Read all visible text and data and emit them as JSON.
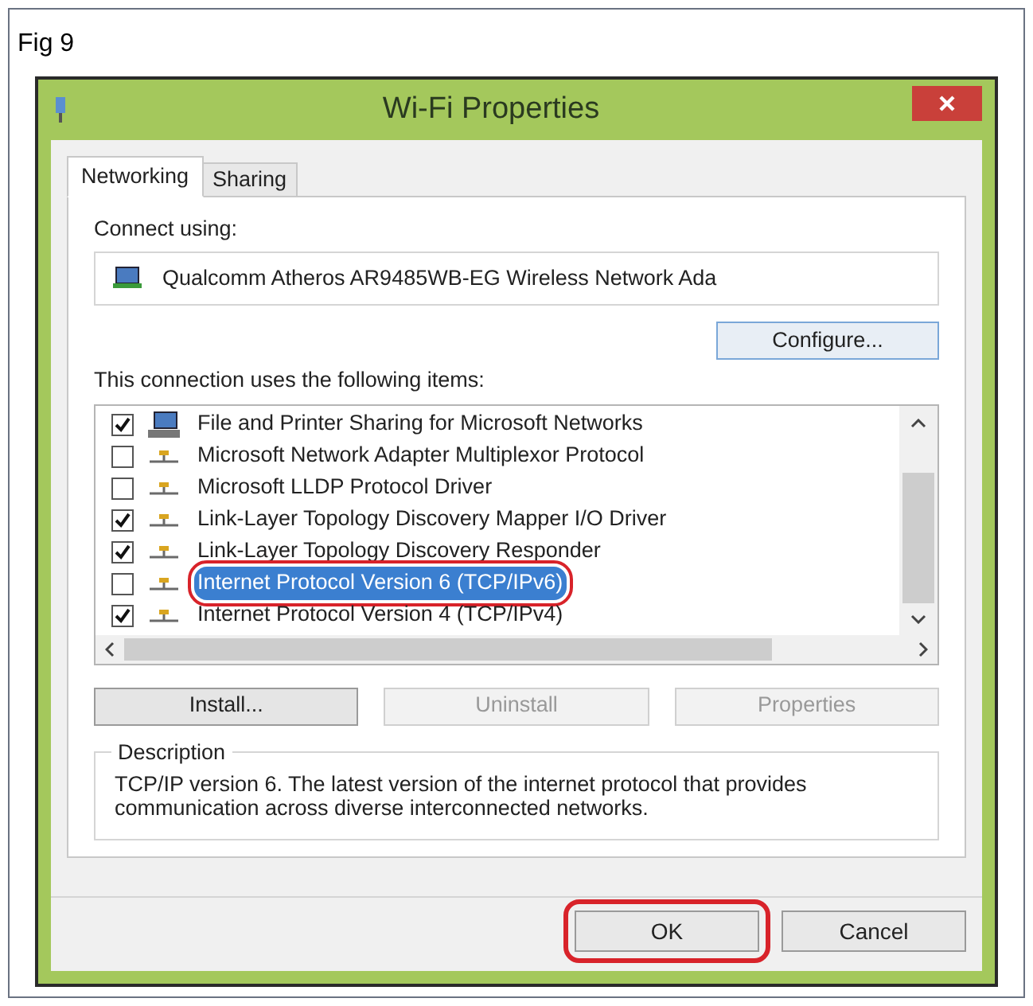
{
  "figure_label": "Fig 9",
  "window": {
    "title": "Wi-Fi Properties"
  },
  "tabs": [
    {
      "label": "Networking",
      "selected": true
    },
    {
      "label": "Sharing",
      "selected": false
    }
  ],
  "connect_using": {
    "label": "Connect using:",
    "adapter": "Qualcomm Atheros AR9485WB-EG Wireless Network Ada",
    "configure_button": "Configure..."
  },
  "items": {
    "label": "This connection uses the following items:",
    "list": [
      {
        "kind": "client",
        "text": "File and Printer Sharing for Microsoft Networks",
        "checked": true,
        "selected": false,
        "highlighted": false
      },
      {
        "kind": "protocol",
        "text": "Microsoft Network Adapter Multiplexor Protocol",
        "checked": false,
        "selected": false,
        "highlighted": false
      },
      {
        "kind": "protocol",
        "text": "Microsoft LLDP Protocol Driver",
        "checked": false,
        "selected": false,
        "highlighted": false
      },
      {
        "kind": "protocol",
        "text": "Link-Layer Topology Discovery Mapper I/O Driver",
        "checked": true,
        "selected": false,
        "highlighted": false
      },
      {
        "kind": "protocol",
        "text": "Link-Layer Topology Discovery Responder",
        "checked": true,
        "selected": false,
        "highlighted": false
      },
      {
        "kind": "protocol",
        "text": "Internet Protocol Version 6 (TCP/IPv6)",
        "checked": false,
        "selected": true,
        "highlighted": true
      },
      {
        "kind": "protocol",
        "text": "Internet Protocol Version 4 (TCP/IPv4)",
        "checked": true,
        "selected": false,
        "highlighted": false
      }
    ]
  },
  "action_buttons": [
    {
      "label": "Install...",
      "disabled": false
    },
    {
      "label": "Uninstall",
      "disabled": true
    },
    {
      "label": "Properties",
      "disabled": true
    }
  ],
  "description": {
    "label": "Description",
    "text": "TCP/IP version 6. The latest version of the internet protocol that provides communication across diverse interconnected networks."
  },
  "footer_buttons": [
    {
      "label": "OK",
      "highlighted": true
    },
    {
      "label": "Cancel",
      "highlighted": false
    }
  ]
}
